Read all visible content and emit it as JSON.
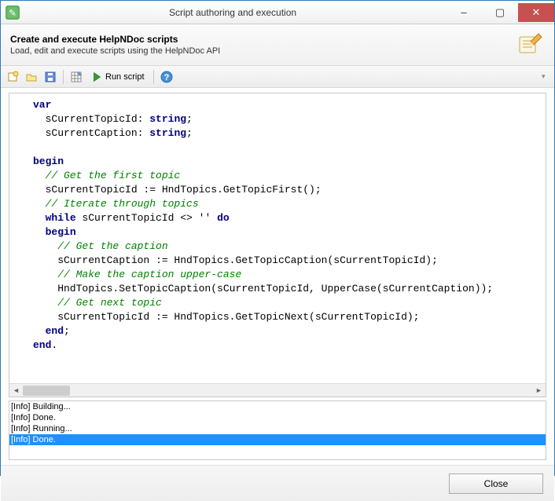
{
  "window": {
    "title": "Script authoring and execution",
    "minimize": "–",
    "maximize": "▢",
    "close": "✕"
  },
  "header": {
    "title": "Create and execute HelpNDoc scripts",
    "subtitle": "Load, edit and execute scripts using the HelpNDoc API"
  },
  "toolbar": {
    "run_label": "Run script"
  },
  "code": {
    "l1_kw": "var",
    "l2a": "  sCurrentTopicId: ",
    "l2b": "string",
    "l2c": ";",
    "l3a": "  sCurrentCaption: ",
    "l3b": "string",
    "l3c": ";",
    "l5_kw": "begin",
    "l6_cm": "  // Get the first topic",
    "l7": "  sCurrentTopicId := HndTopics.GetTopicFirst();",
    "l8_cm": "  // Iterate through topics",
    "l9a": "  ",
    "l9b": "while",
    "l9c": " sCurrentTopicId <> '' ",
    "l9d": "do",
    "l10a": "  ",
    "l10b": "begin",
    "l11_cm": "    // Get the caption",
    "l12": "    sCurrentCaption := HndTopics.GetTopicCaption(sCurrentTopicId);",
    "l13_cm": "    // Make the caption upper-case",
    "l14": "    HndTopics.SetTopicCaption(sCurrentTopicId, UpperCase(sCurrentCaption));",
    "l15_cm": "    // Get next topic",
    "l16": "    sCurrentTopicId := HndTopics.GetTopicNext(sCurrentTopicId);",
    "l17a": "  ",
    "l17b": "end",
    "l17c": ";",
    "l18a": "",
    "l18b": "end",
    "l18c": "."
  },
  "output": {
    "lines": [
      "[Info] Building...",
      "[Info] Done.",
      "[Info] Running...",
      "[Info] Done."
    ]
  },
  "footer": {
    "close_label": "Close"
  }
}
